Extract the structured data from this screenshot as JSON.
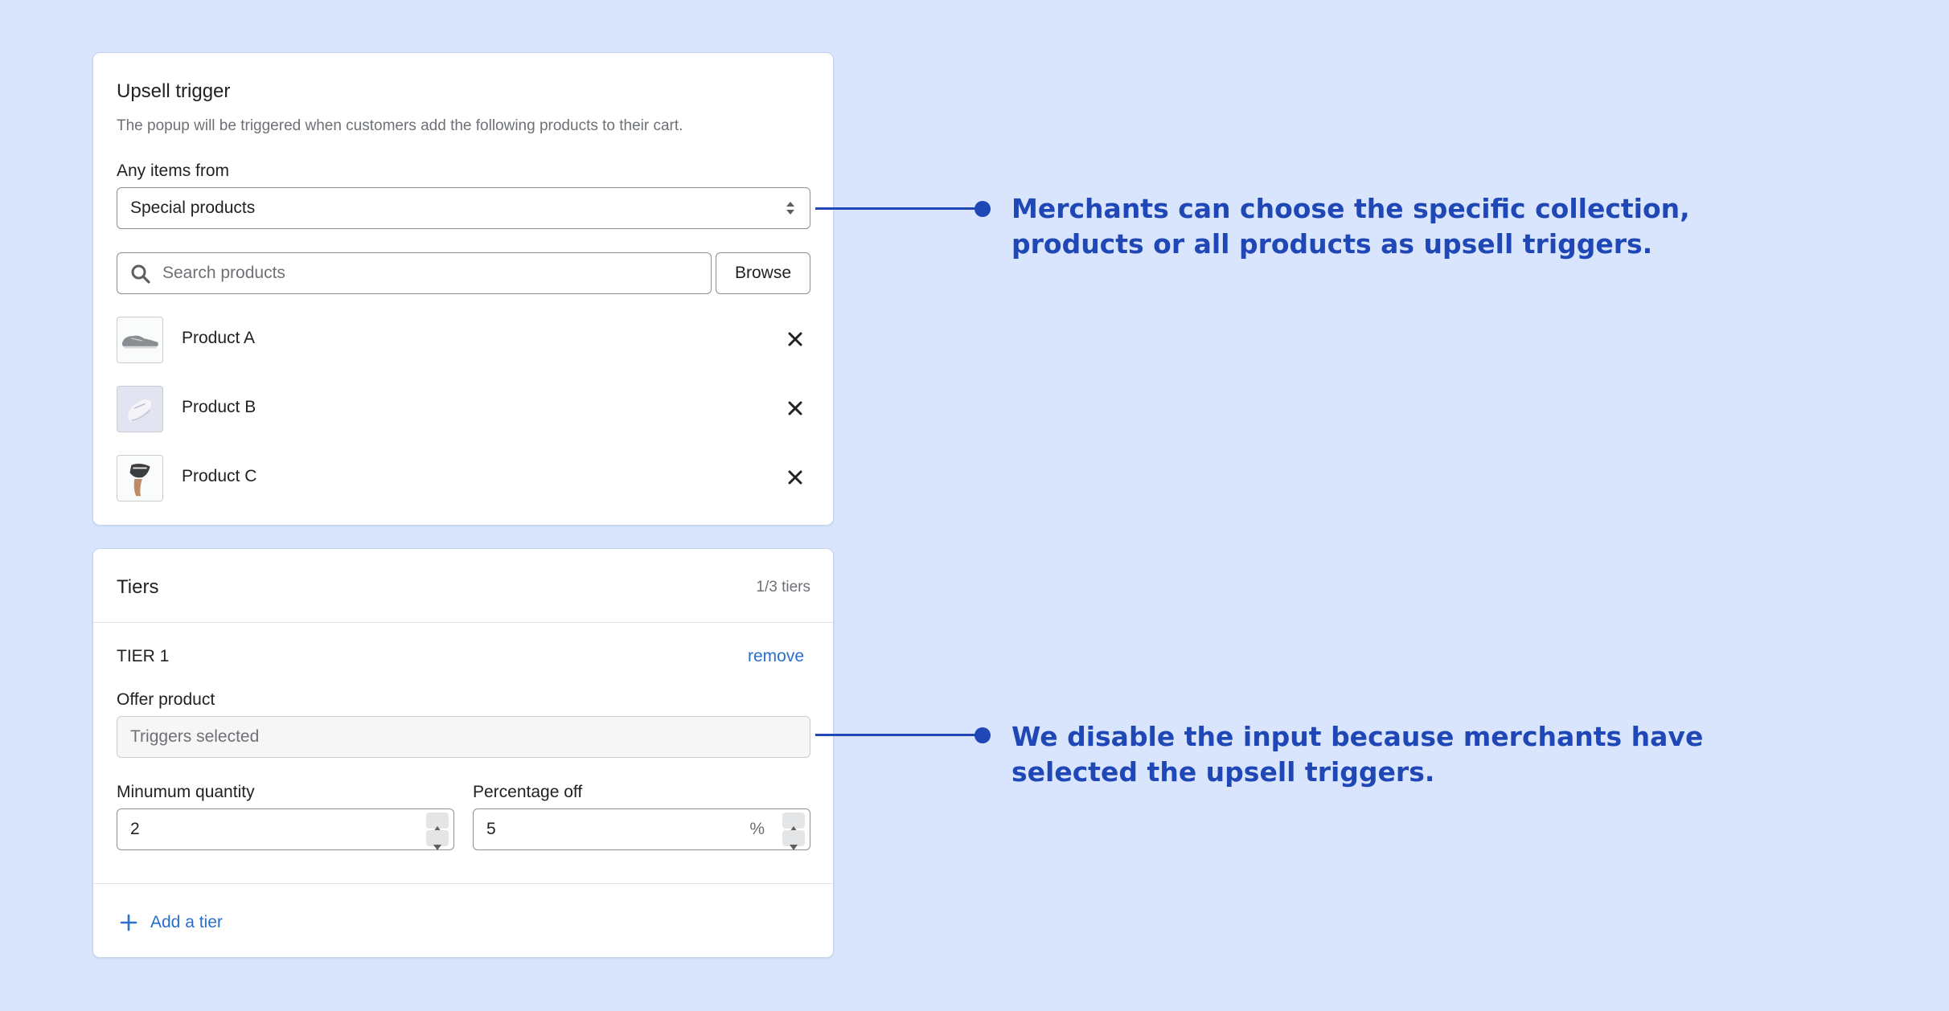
{
  "trigger_card": {
    "title": "Upsell trigger",
    "description": "The popup will be triggered when customers add the following products to their cart.",
    "any_items_label": "Any items from",
    "collection_value": "Special products",
    "search_placeholder": "Search products",
    "browse_label": "Browse",
    "products": [
      {
        "name": "Product A",
        "thumb_icon": "sneaker-grey-icon"
      },
      {
        "name": "Product B",
        "thumb_icon": "sneaker-white-icon"
      },
      {
        "name": "Product C",
        "thumb_icon": "sneaker-hand-icon"
      }
    ]
  },
  "tiers_card": {
    "title": "Tiers",
    "count": "1/3 tiers",
    "tier_label": "TIER 1",
    "remove_label": "remove",
    "offer_label": "Offer product",
    "offer_placeholder": "Triggers selected",
    "min_qty_label": "Minumum quantity",
    "min_qty_value": "2",
    "pct_label": "Percentage off",
    "pct_value": "5",
    "pct_suffix": "%",
    "add_tier_label": "Add a tier"
  },
  "callouts": {
    "first": "Merchants can choose the specific collection, products or all products as upsell triggers.",
    "second": "We disable the input because merchants have selected the upsell triggers."
  },
  "colors": {
    "background": "#d9e5fd",
    "accent": "#1f47b5",
    "link": "#2c6ecb"
  }
}
